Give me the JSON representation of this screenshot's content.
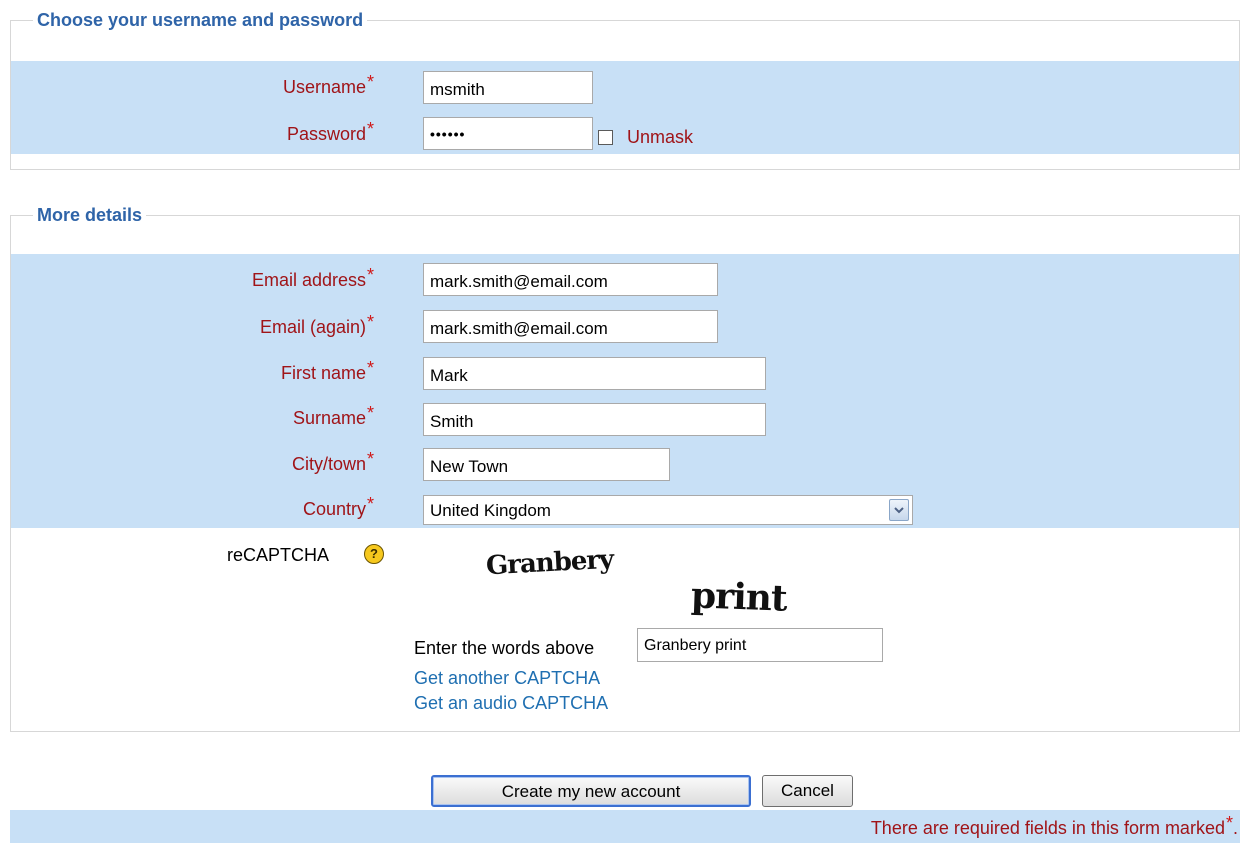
{
  "section_login": {
    "legend": "Choose your username and password",
    "username_label": "Username",
    "username_value": "msmith",
    "password_label": "Password",
    "password_value": "••••••",
    "unmask_label": "Unmask"
  },
  "section_details": {
    "legend": "More details",
    "email_label": "Email address",
    "email_value": "mark.smith@email.com",
    "email2_label": "Email (again)",
    "email2_value": "mark.smith@email.com",
    "firstname_label": "First name",
    "firstname_value": "Mark",
    "surname_label": "Surname",
    "surname_value": "Smith",
    "city_label": "City/town",
    "city_value": "New Town",
    "country_label": "Country",
    "country_value": "United Kingdom",
    "recaptcha_label": "reCAPTCHA",
    "captcha_word1": "Granbery",
    "captcha_word2": "print",
    "captcha_prompt": "Enter the words above",
    "captcha_value": "Granbery print",
    "another_captcha": "Get another CAPTCHA",
    "audio_captcha": "Get an audio CAPTCHA"
  },
  "required_marker": "*",
  "buttons": {
    "create": "Create my new account",
    "cancel": "Cancel"
  },
  "footer_note": "There are required fields in this form marked",
  "footer_note_end": ".",
  "icons": {
    "help": "help-icon",
    "dropdown": "chevron-down-icon"
  },
  "colors": {
    "band": "#c8e0f6",
    "legend": "#2f64a8",
    "label": "#a01418",
    "required": "#d01818",
    "link": "#1f6fb1"
  }
}
